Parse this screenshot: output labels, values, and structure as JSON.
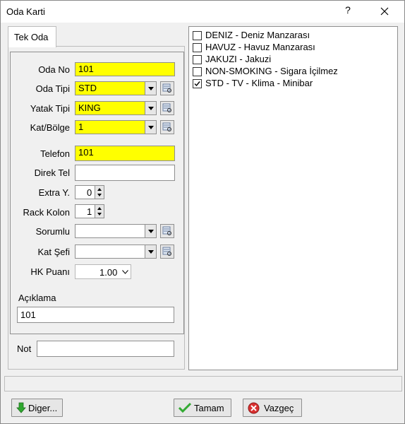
{
  "window": {
    "title": "Oda Karti",
    "help": "?"
  },
  "tab": {
    "label": "Tek Oda"
  },
  "form": {
    "oda_no": {
      "label": "Oda No",
      "value": "101"
    },
    "oda_tipi": {
      "label": "Oda Tipi",
      "value": "STD"
    },
    "yatak_tipi": {
      "label": "Yatak Tipi",
      "value": "KING"
    },
    "kat_bolge": {
      "label": "Kat/Bölge",
      "value": "1"
    },
    "telefon": {
      "label": "Telefon",
      "value": "101"
    },
    "direk_tel": {
      "label": "Direk Tel",
      "value": ""
    },
    "extra_y": {
      "label": "Extra Y.",
      "value": "0"
    },
    "rack_kolon": {
      "label": "Rack Kolon",
      "value": "1"
    },
    "sorumlu": {
      "label": "Sorumlu",
      "value": ""
    },
    "kat_sefi": {
      "label": "Kat Şefi",
      "value": ""
    },
    "hk_puani": {
      "label": "HK Puanı",
      "value": "1.00"
    },
    "aciklama": {
      "label": "Açıklama",
      "value": "101"
    },
    "not": {
      "label": "Not",
      "value": ""
    }
  },
  "features": [
    {
      "label": "DENIZ - Deniz Manzarası",
      "checked": false
    },
    {
      "label": "HAVUZ - Havuz Manzarası",
      "checked": false
    },
    {
      "label": "JAKUZI - Jakuzi",
      "checked": false
    },
    {
      "label": "NON-SMOKING - Sigara İçilmez",
      "checked": false
    },
    {
      "label": "STD - TV - Klima - Minibar",
      "checked": true
    }
  ],
  "buttons": {
    "diger": "Diger...",
    "tamam": "Tamam",
    "vazgec": "Vazgeç"
  },
  "colors": {
    "required_field": "#ffff00"
  },
  "icons": {
    "close": "close-icon",
    "dropdown": "chevron-down-icon",
    "lookup": "lookup-icon",
    "diger": "green-arrow-down-icon",
    "tamam": "green-check-icon",
    "vazgec": "red-cancel-icon"
  }
}
